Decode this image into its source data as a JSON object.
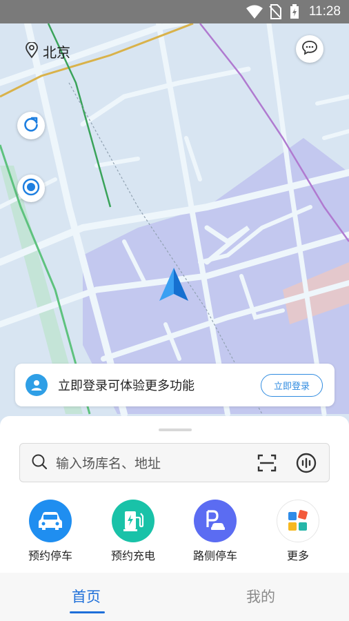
{
  "status_bar": {
    "time": "11:28",
    "icons": [
      "wifi-icon",
      "no-sim-icon",
      "battery-charging-icon"
    ]
  },
  "map": {
    "city": "北京",
    "icons": {
      "location_pin": "location-pin-icon",
      "message": "message-icon",
      "refresh": "refresh-icon",
      "locate": "locate-icon",
      "nav_arrow": "navigation-arrow-icon"
    }
  },
  "login_banner": {
    "message": "立即登录可体验更多功能",
    "button": "立即登录"
  },
  "search": {
    "placeholder": "输入场库名、地址",
    "icons": [
      "search-icon",
      "scan-icon",
      "voice-icon"
    ]
  },
  "quick_actions": [
    {
      "label": "预约停车",
      "icon": "car-icon",
      "color": "#1f8ef0"
    },
    {
      "label": "预约充电",
      "icon": "charging-station-icon",
      "color": "#19c2a8"
    },
    {
      "label": "路侧停车",
      "icon": "roadside-parking-icon",
      "color": "#5b6cf2"
    },
    {
      "label": "更多",
      "icon": "more-grid-icon",
      "color": "#ffffff"
    }
  ],
  "tabs": [
    {
      "label": "首页",
      "active": true
    },
    {
      "label": "我的",
      "active": false
    }
  ],
  "colors": {
    "accent": "#1e6fd9",
    "map_base": "#d8e5f2",
    "map_district": "#c3c8ef",
    "road": "#eef6fb"
  }
}
